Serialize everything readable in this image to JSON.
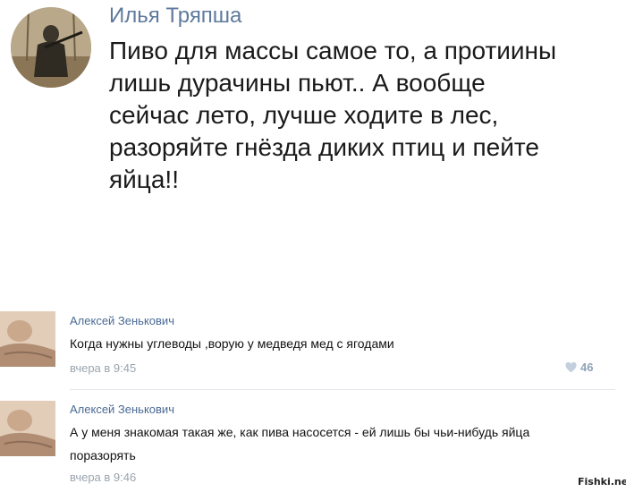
{
  "post": {
    "author": "Илья Тряпша",
    "text_lines": [
      "Пиво для массы самое то, а протиины",
      "лишь дурачины пьют.. А вообще",
      "сейчас лето, лучше ходите в лес,",
      "разоряйте гнёзда диких птиц и пейте",
      "яйца!!"
    ]
  },
  "comments": [
    {
      "author": "Алексей Зенькович",
      "text": "Когда нужны углеводы ,ворую у медведя мед с ягодами",
      "time": "вчера в 9:45",
      "likes": "46"
    },
    {
      "author": "Алексей Зенькович",
      "text_lines": [
        "А у меня знакомая такая же, как пива насосется - ей лишь бы чьи-нибудь яйца",
        "поразорять"
      ],
      "time": "вчера в 9:46"
    }
  ],
  "watermark": "Fishki.net",
  "colors": {
    "author_link": "#5f7a9c",
    "comment_author": "#4a6a94",
    "meta_gray": "#9aa4ae",
    "like_blue": "#8ea2b8"
  },
  "icons": {
    "like": "heart-icon"
  }
}
